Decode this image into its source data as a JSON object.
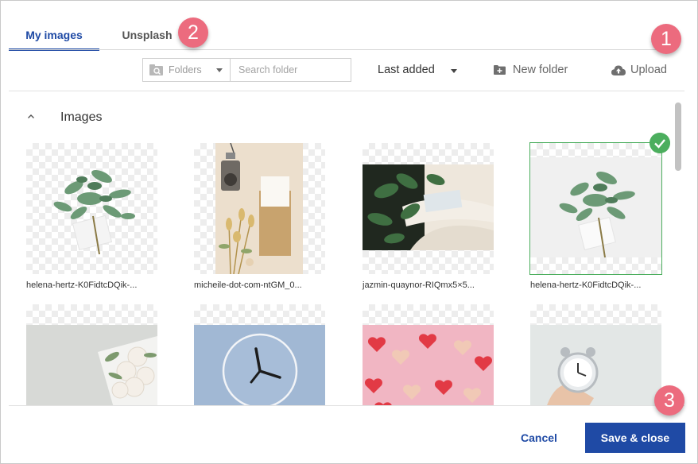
{
  "tabs": [
    {
      "label": "My images",
      "active": true
    },
    {
      "label": "Unsplash",
      "active": false
    }
  ],
  "badges": [
    "1",
    "2",
    "3"
  ],
  "toolbar": {
    "folders_label": "Folders",
    "search_placeholder": "Search folder",
    "sort_label": "Last added",
    "new_folder_label": "New folder",
    "upload_label": "Upload"
  },
  "section": {
    "title": "Images",
    "items": [
      {
        "caption": "helena-hertz-K0FidtcDQik-...",
        "selected": false
      },
      {
        "caption": "micheile-dot-com-ntGM_0...",
        "selected": false
      },
      {
        "caption": "jazmin-quaynor-RIQmx5×5...",
        "selected": false
      },
      {
        "caption": "helena-hertz-K0FidtcDQik-...",
        "selected": true
      },
      {
        "caption": "",
        "selected": false
      },
      {
        "caption": "",
        "selected": false
      },
      {
        "caption": "",
        "selected": false
      },
      {
        "caption": "",
        "selected": false
      }
    ]
  },
  "footer": {
    "cancel_label": "Cancel",
    "save_label": "Save & close"
  },
  "colors": {
    "accent": "#1f4aa5",
    "badge": "#ec6b7e",
    "selected": "#4cae5e"
  }
}
